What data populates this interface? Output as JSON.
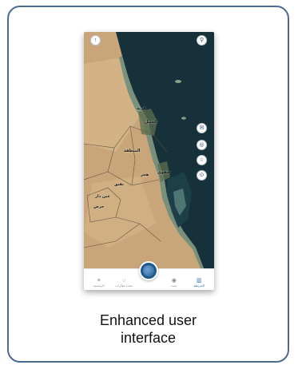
{
  "caption": {
    "line1": "Enhanced user",
    "line2": "interface"
  },
  "map": {
    "labels": [
      "الجبيل",
      "قرية",
      "المنطقة",
      "هجر",
      "صفوى",
      "بقيق",
      "عين دار",
      "حرض"
    ]
  },
  "floating_buttons": {
    "top_left": "↑",
    "top_right": "⚲",
    "right_1": "✉",
    "right_2": "◎",
    "right_3": "☆",
    "right_4": "⊙"
  },
  "bottom_nav": {
    "items": [
      {
        "label": "الرئيسية",
        "icon": "≡"
      },
      {
        "label": "بحث عقارات",
        "icon": "○"
      },
      {
        "label": "بحث",
        "icon": "◉"
      },
      {
        "label": "الخريطة",
        "icon": "▥"
      }
    ]
  },
  "colors": {
    "card_border": "#4a6a92",
    "sea": "#16313a",
    "land": "#c9a67a",
    "nav_active": "#2f6fb2",
    "center_button": "#1f5a8f"
  }
}
